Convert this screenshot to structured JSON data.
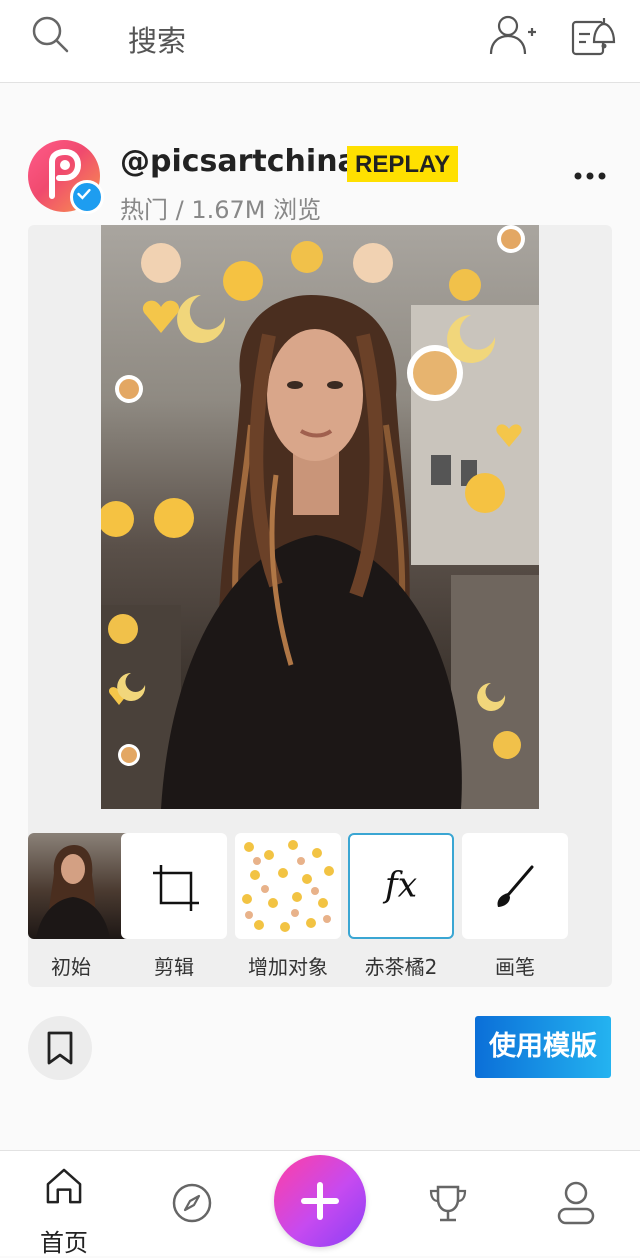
{
  "header": {
    "search_label": "搜索",
    "icons": [
      "search-icon",
      "add-user-icon",
      "notification-icon"
    ]
  },
  "post": {
    "username": "@picsartchina",
    "badge": "REPLAY",
    "meta": "热门 / 1.67M 浏览",
    "verified": true
  },
  "steps": [
    {
      "label": "初始",
      "icon": "original-thumbnail"
    },
    {
      "label": "剪辑",
      "icon": "crop-icon"
    },
    {
      "label": "增加对象",
      "icon": "sticker-thumbnail"
    },
    {
      "label": "赤茶橘2",
      "icon": "fx-icon",
      "selected": true
    },
    {
      "label": "画笔",
      "icon": "brush-icon"
    }
  ],
  "actions": {
    "use_template": "使用模版"
  },
  "bottom_nav": {
    "home_label": "首页",
    "items": [
      "home-icon",
      "explore-icon",
      "add-icon",
      "trophy-icon",
      "profile-icon"
    ]
  },
  "colors": {
    "replay_bg": "#ffe000",
    "accent_blue": "#1e9df0",
    "fab_gradient": [
      "#ff3fa4",
      "#8a3ff5"
    ]
  }
}
